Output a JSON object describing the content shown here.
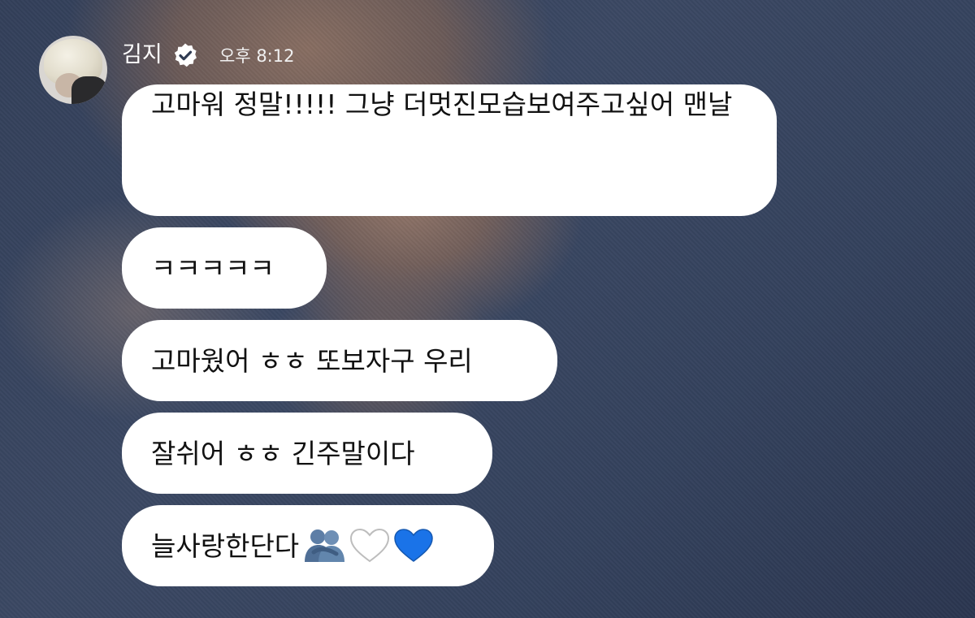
{
  "header": {
    "author_name": "김지",
    "verified_icon": "verified-check-badge-icon",
    "timestamp": "오후 8:12"
  },
  "messages": [
    {
      "text": "고마워 정말!!!!! 그냥 더멋진모습보여주고싶어 맨날"
    },
    {
      "text": "ㅋㅋㅋㅋㅋ"
    },
    {
      "text": "고마웠어 ㅎㅎ 또보자구 우리"
    },
    {
      "text": "잘쉬어 ㅎㅎ 긴주말이다"
    },
    {
      "text": "늘사랑한단다",
      "emojis": [
        "people-hugging-emoji",
        "white-heart-emoji",
        "blue-heart-emoji"
      ]
    }
  ],
  "colors": {
    "bubble": "#ffffff",
    "bubble_text": "#111111",
    "header_text": "#ffffff",
    "blue_heart": "#1a73e8"
  }
}
